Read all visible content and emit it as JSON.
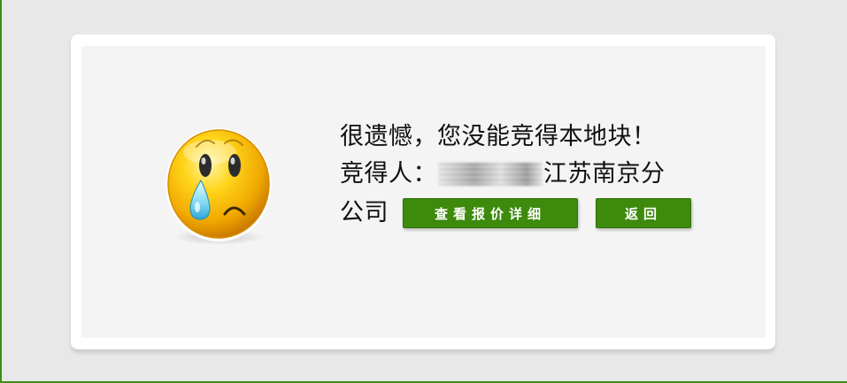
{
  "message": {
    "line1": "很遗憾，您没能竞得本地块！",
    "winner_label": "竞得人：",
    "winner_name_suffix": "江苏南京分",
    "winner_name_end": "公司"
  },
  "buttons": {
    "view_quote_details": "查看报价详细",
    "back": "返回"
  },
  "icons": {
    "sad_face": "crying-face-icon"
  },
  "colors": {
    "accent": "#3d8a0c",
    "page_background": "#e9e8e8",
    "panel_background": "#f4f4f4"
  }
}
